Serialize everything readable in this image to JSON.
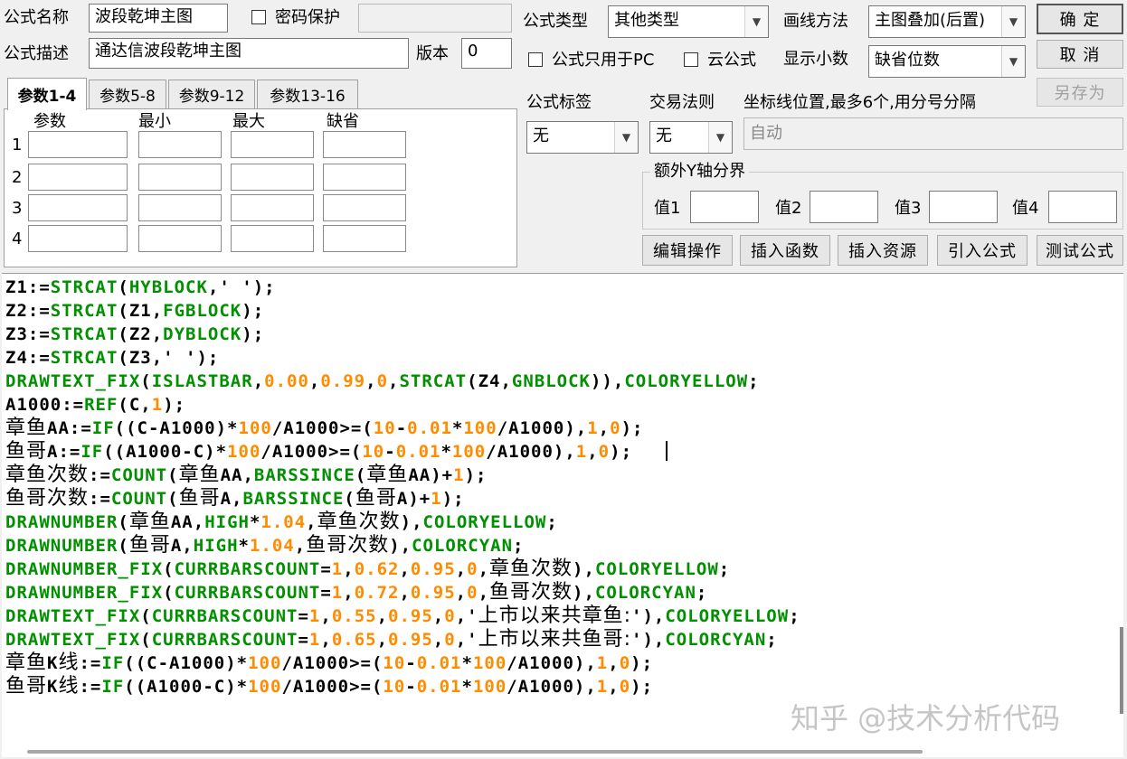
{
  "form": {
    "name_label": "公式名称",
    "name_value": "波段乾坤主图",
    "password_label": "密码保护",
    "password_checked": false,
    "desc_label": "公式描述",
    "desc_value": "通达信波段乾坤主图",
    "version_label": "版本",
    "version_value": "0",
    "type_label": "公式类型",
    "type_value": "其他类型",
    "draw_label": "画线方法",
    "draw_value": "主图叠加(后置)",
    "pc_only_label": "公式只用于PC",
    "pc_only_checked": false,
    "cloud_label": "云公式",
    "cloud_checked": false,
    "decimals_label": "显示小数",
    "decimals_value": "缺省位数",
    "tag_label": "公式标签",
    "tag_value": "无",
    "rule_label": "交易法则",
    "rule_value": "无",
    "axis_label": "坐标线位置,最多6个,用分号分隔",
    "axis_value": "自动",
    "yaxis_group": "额外Y轴分界",
    "yaxis_values": [
      "值1",
      "值2",
      "值3",
      "值4"
    ]
  },
  "buttons": {
    "ok": "确  定",
    "cancel": "取  消",
    "save_as": "另存为",
    "edit": "编辑操作",
    "insert_fn": "插入函数",
    "insert_res": "插入资源",
    "import": "引入公式",
    "test": "测试公式"
  },
  "tabs": [
    "参数1-4",
    "参数5-8",
    "参数9-12",
    "参数13-16"
  ],
  "params": {
    "headers": [
      "参数",
      "最小",
      "最大",
      "缺省"
    ],
    "rows": [
      "1",
      "2",
      "3",
      "4"
    ]
  },
  "code_lines": [
    [
      [
        "v",
        "Z1:="
      ],
      [
        "f",
        "STRCAT"
      ],
      [
        "o",
        "("
      ],
      [
        "f",
        "HYBLOCK"
      ],
      [
        "o",
        ",' ');"
      ]
    ],
    [
      [
        "v",
        "Z2:="
      ],
      [
        "f",
        "STRCAT"
      ],
      [
        "o",
        "(Z1,"
      ],
      [
        "f",
        "FGBLOCK"
      ],
      [
        "o",
        ");"
      ]
    ],
    [
      [
        "v",
        "Z3:="
      ],
      [
        "f",
        "STRCAT"
      ],
      [
        "o",
        "(Z2,"
      ],
      [
        "f",
        "DYBLOCK"
      ],
      [
        "o",
        ");"
      ]
    ],
    [
      [
        "v",
        "Z4:="
      ],
      [
        "f",
        "STRCAT"
      ],
      [
        "o",
        "(Z3,' ');"
      ]
    ],
    [
      [
        "f",
        "DRAWTEXT_FIX"
      ],
      [
        "o",
        "("
      ],
      [
        "f",
        "ISLASTBAR"
      ],
      [
        "o",
        ","
      ],
      [
        "n",
        "0.00"
      ],
      [
        "o",
        ","
      ],
      [
        "n",
        "0.99"
      ],
      [
        "o",
        ","
      ],
      [
        "n",
        "0"
      ],
      [
        "o",
        ","
      ],
      [
        "f",
        "STRCAT"
      ],
      [
        "o",
        "(Z4,"
      ],
      [
        "f",
        "GNBLOCK"
      ],
      [
        "o",
        "))"
      ],
      [
        "o",
        ","
      ],
      [
        "f",
        "COLORYELLOW"
      ],
      [
        "o",
        ";"
      ]
    ],
    [
      [
        "v",
        "A1000:="
      ],
      [
        "f",
        "REF"
      ],
      [
        "o",
        "(C,"
      ],
      [
        "n",
        "1"
      ],
      [
        "o",
        ");"
      ]
    ],
    [
      [
        "c",
        "章鱼"
      ],
      [
        "v",
        "AA:="
      ],
      [
        "f",
        "IF"
      ],
      [
        "o",
        "((C-A1000)*"
      ],
      [
        "n",
        "100"
      ],
      [
        "o",
        "/A1000>=("
      ],
      [
        "n",
        "10"
      ],
      [
        "o",
        "-"
      ],
      [
        "n",
        "0.01"
      ],
      [
        "o",
        "*"
      ],
      [
        "n",
        "100"
      ],
      [
        "o",
        "/A1000),"
      ],
      [
        "n",
        "1"
      ],
      [
        "o",
        ","
      ],
      [
        "n",
        "0"
      ],
      [
        "o",
        ");"
      ]
    ],
    [
      [
        "c",
        "鱼哥"
      ],
      [
        "v",
        "A:="
      ],
      [
        "f",
        "IF"
      ],
      [
        "o",
        "((A1000-C)*"
      ],
      [
        "n",
        "100"
      ],
      [
        "o",
        "/A1000>=("
      ],
      [
        "n",
        "10"
      ],
      [
        "o",
        "-"
      ],
      [
        "n",
        "0.01"
      ],
      [
        "o",
        "*"
      ],
      [
        "n",
        "100"
      ],
      [
        "o",
        "/A1000),"
      ],
      [
        "n",
        "1"
      ],
      [
        "o",
        ","
      ],
      [
        "n",
        "0"
      ],
      [
        "o",
        ");"
      ]
    ],
    [
      [
        "c",
        "章鱼次数"
      ],
      [
        "v",
        ":="
      ],
      [
        "f",
        "COUNT"
      ],
      [
        "o",
        "("
      ],
      [
        "c",
        "章鱼"
      ],
      [
        "v",
        "AA,"
      ],
      [
        "f",
        "BARSSINCE"
      ],
      [
        "o",
        "("
      ],
      [
        "c",
        "章鱼"
      ],
      [
        "v",
        "AA"
      ],
      [
        "o",
        ")+"
      ],
      [
        "n",
        "1"
      ],
      [
        "o",
        ");"
      ]
    ],
    [
      [
        "c",
        "鱼哥次数"
      ],
      [
        "v",
        ":="
      ],
      [
        "f",
        "COUNT"
      ],
      [
        "o",
        "("
      ],
      [
        "c",
        "鱼哥"
      ],
      [
        "v",
        "A,"
      ],
      [
        "f",
        "BARSSINCE"
      ],
      [
        "o",
        "("
      ],
      [
        "c",
        "鱼哥"
      ],
      [
        "v",
        "A"
      ],
      [
        "o",
        ")+"
      ],
      [
        "n",
        "1"
      ],
      [
        "o",
        ");"
      ]
    ],
    [
      [
        "f",
        "DRAWNUMBER"
      ],
      [
        "o",
        "("
      ],
      [
        "c",
        "章鱼"
      ],
      [
        "v",
        "AA,"
      ],
      [
        "f",
        "HIGH"
      ],
      [
        "o",
        "*"
      ],
      [
        "n",
        "1.04"
      ],
      [
        "o",
        ","
      ],
      [
        "c",
        "章鱼次数"
      ],
      [
        "o",
        "),"
      ],
      [
        "f",
        "COLORYELLOW"
      ],
      [
        "o",
        ";"
      ]
    ],
    [
      [
        "f",
        "DRAWNUMBER"
      ],
      [
        "o",
        "("
      ],
      [
        "c",
        "鱼哥"
      ],
      [
        "v",
        "A,"
      ],
      [
        "f",
        "HIGH"
      ],
      [
        "o",
        "*"
      ],
      [
        "n",
        "1.04"
      ],
      [
        "o",
        ","
      ],
      [
        "c",
        "鱼哥次数"
      ],
      [
        "o",
        "),"
      ],
      [
        "f",
        "COLORCYAN"
      ],
      [
        "o",
        ";"
      ]
    ],
    [
      [
        "f",
        "DRAWNUMBER_FIX"
      ],
      [
        "o",
        "("
      ],
      [
        "f",
        "CURRBARSCOUNT"
      ],
      [
        "o",
        "="
      ],
      [
        "n",
        "1"
      ],
      [
        "o",
        ","
      ],
      [
        "n",
        "0.62"
      ],
      [
        "o",
        ","
      ],
      [
        "n",
        "0.95"
      ],
      [
        "o",
        ","
      ],
      [
        "n",
        "0"
      ],
      [
        "o",
        ","
      ],
      [
        "c",
        "章鱼次数"
      ],
      [
        "o",
        "),"
      ],
      [
        "f",
        "COLORYELLOW"
      ],
      [
        "o",
        ";"
      ]
    ],
    [
      [
        "f",
        "DRAWNUMBER_FIX"
      ],
      [
        "o",
        "("
      ],
      [
        "f",
        "CURRBARSCOUNT"
      ],
      [
        "o",
        "="
      ],
      [
        "n",
        "1"
      ],
      [
        "o",
        ","
      ],
      [
        "n",
        "0.72"
      ],
      [
        "o",
        ","
      ],
      [
        "n",
        "0.95"
      ],
      [
        "o",
        ","
      ],
      [
        "n",
        "0"
      ],
      [
        "o",
        ","
      ],
      [
        "c",
        "鱼哥次数"
      ],
      [
        "o",
        "),"
      ],
      [
        "f",
        "COLORCYAN"
      ],
      [
        "o",
        ";"
      ]
    ],
    [
      [
        "f",
        "DRAWTEXT_FIX"
      ],
      [
        "o",
        "("
      ],
      [
        "f",
        "CURRBARSCOUNT"
      ],
      [
        "o",
        "="
      ],
      [
        "n",
        "1"
      ],
      [
        "o",
        ","
      ],
      [
        "n",
        "0.55"
      ],
      [
        "o",
        ","
      ],
      [
        "n",
        "0.95"
      ],
      [
        "o",
        ","
      ],
      [
        "n",
        "0"
      ],
      [
        "o",
        ",'"
      ],
      [
        "c",
        "上市以来共章鱼:"
      ],
      [
        "o",
        "'),"
      ],
      [
        "f",
        "COLORYELLOW"
      ],
      [
        "o",
        ";"
      ]
    ],
    [
      [
        "f",
        "DRAWTEXT_FIX"
      ],
      [
        "o",
        "("
      ],
      [
        "f",
        "CURRBARSCOUNT"
      ],
      [
        "o",
        "="
      ],
      [
        "n",
        "1"
      ],
      [
        "o",
        ","
      ],
      [
        "n",
        "0.65"
      ],
      [
        "o",
        ","
      ],
      [
        "n",
        "0.95"
      ],
      [
        "o",
        ","
      ],
      [
        "n",
        "0"
      ],
      [
        "o",
        ",'"
      ],
      [
        "c",
        "上市以来共鱼哥:"
      ],
      [
        "o",
        "'),"
      ],
      [
        "f",
        "COLORCYAN"
      ],
      [
        "o",
        ";"
      ]
    ],
    [
      [
        "c",
        "章鱼"
      ],
      [
        "v",
        "K"
      ],
      [
        "c",
        "线"
      ],
      [
        "v",
        ":="
      ],
      [
        "f",
        "IF"
      ],
      [
        "o",
        "((C-A1000)*"
      ],
      [
        "n",
        "100"
      ],
      [
        "o",
        "/A1000>=("
      ],
      [
        "n",
        "10"
      ],
      [
        "o",
        "-"
      ],
      [
        "n",
        "0.01"
      ],
      [
        "o",
        "*"
      ],
      [
        "n",
        "100"
      ],
      [
        "o",
        "/A1000),"
      ],
      [
        "n",
        "1"
      ],
      [
        "o",
        ","
      ],
      [
        "n",
        "0"
      ],
      [
        "o",
        ");"
      ]
    ],
    [
      [
        "c",
        "鱼哥"
      ],
      [
        "v",
        "K"
      ],
      [
        "c",
        "线"
      ],
      [
        "v",
        ":="
      ],
      [
        "f",
        "IF"
      ],
      [
        "o",
        "((A1000-C)*"
      ],
      [
        "n",
        "100"
      ],
      [
        "o",
        "/A1000>=("
      ],
      [
        "n",
        "10"
      ],
      [
        "o",
        "-"
      ],
      [
        "n",
        "0.01"
      ],
      [
        "o",
        "*"
      ],
      [
        "n",
        "100"
      ],
      [
        "o",
        "/A1000),"
      ],
      [
        "n",
        "1"
      ],
      [
        "o",
        ","
      ],
      [
        "n",
        "0"
      ],
      [
        "o",
        ");"
      ]
    ]
  ],
  "watermark": "知乎 @技术分析代码",
  "colors": {
    "function": "#009000",
    "number": "#ff8c00",
    "text": "#000000"
  }
}
